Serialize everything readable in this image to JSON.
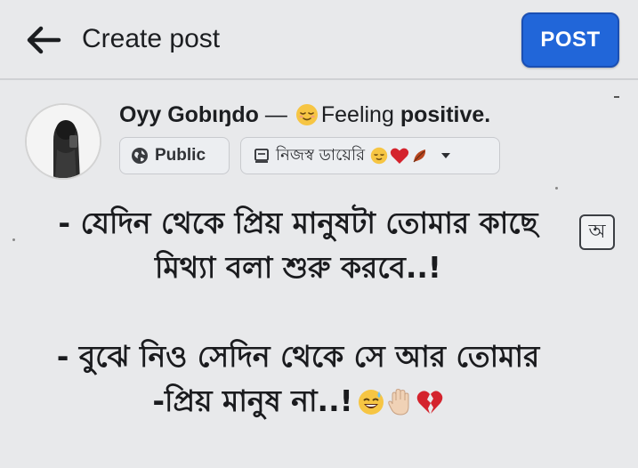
{
  "header": {
    "title": "Create post",
    "post_label": "POST"
  },
  "profile": {
    "name": "Oyy Gobιŋdo",
    "separator": "—",
    "feeling_prefix": "Feeling",
    "feeling_value": "positive."
  },
  "audience": {
    "label": "Public"
  },
  "album": {
    "label": "নিজস্ব ডায়েরি"
  },
  "translate_button": {
    "glyph": "অ"
  },
  "post_body": {
    "lines": [
      "- যেদিন থেকে প্রিয় মানুষটা তোমার কাছে",
      "মিথ্যা বলা শুরু করবে..!",
      "- বুঝে নিও সেদিন থেকে সে আর তোমার",
      "-প্রিয় মানুষ না..!"
    ]
  },
  "colors": {
    "background": "#e8e9eb",
    "post_button": "#2166d9",
    "text": "#1c1e21"
  },
  "icons": {
    "back": "arrow-left-icon",
    "public": "globe-icon",
    "album": "album-icon",
    "caret": "caret-down-icon",
    "translate": "translate-icon"
  }
}
